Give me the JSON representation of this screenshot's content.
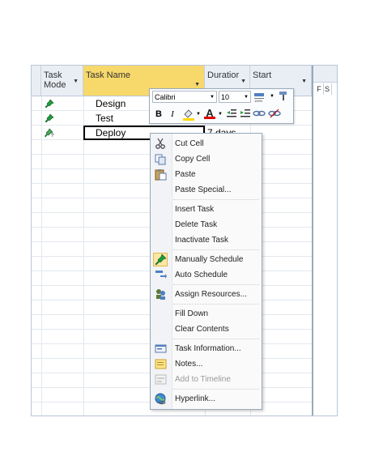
{
  "columns": {
    "task_mode": "Task\nMode",
    "task_name": "Task Name",
    "duration": "Duratior",
    "start": "Start",
    "gantt_f": "F",
    "gantt_s": "S"
  },
  "tasks": [
    {
      "name": "Design"
    },
    {
      "name": "Test"
    },
    {
      "name": "Deploy",
      "duration": "7 days"
    }
  ],
  "toolbar": {
    "font": "Calibri",
    "size": "10",
    "bold": "B",
    "italic": "I",
    "font_color_letter": "A"
  },
  "menu": {
    "cut": "Cut Cell",
    "copy": "Copy Cell",
    "paste": "Paste",
    "paste_special": "Paste Special...",
    "insert_task": "Insert Task",
    "delete_task": "Delete Task",
    "inactivate_task": "Inactivate Task",
    "manually_schedule": "Manually Schedule",
    "auto_schedule": "Auto Schedule",
    "assign_resources": "Assign Resources...",
    "fill_down": "Fill Down",
    "clear_contents": "Clear Contents",
    "task_information": "Task Information...",
    "notes": "Notes...",
    "add_to_timeline": "Add to Timeline",
    "hyperlink": "Hyperlink..."
  },
  "colors": {
    "selected_header": "#f7d86b",
    "header_bg": "#e9eef5",
    "pin_green": "#1f9b3e"
  }
}
